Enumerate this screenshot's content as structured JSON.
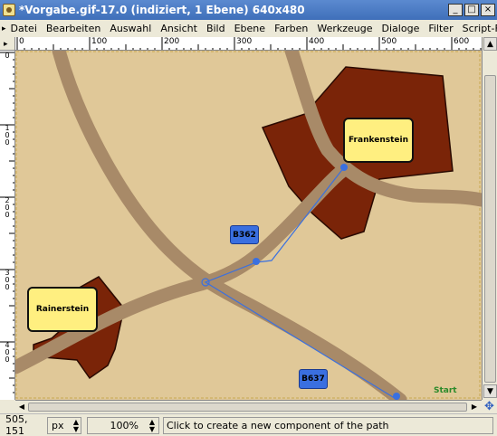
{
  "window": {
    "title": "*Vorgabe.gif-17.0 (indiziert, 1 Ebene) 640x480",
    "minimize_label": "_",
    "maximize_label": "□",
    "close_label": "×"
  },
  "menu": {
    "items": [
      "Datei",
      "Bearbeiten",
      "Auswahl",
      "Ansicht",
      "Bild",
      "Ebene",
      "Farben",
      "Werkzeuge",
      "Dialoge",
      "Filter",
      "Script-Fu"
    ]
  },
  "ruler": {
    "h_labels": [
      "0",
      "100",
      "200",
      "300",
      "400",
      "500",
      "600"
    ],
    "v_labels": [
      "0",
      "100",
      "200",
      "300",
      "400"
    ]
  },
  "map": {
    "towns": [
      "Frankenstein",
      "Rainerstein"
    ],
    "road_signs": [
      "B362",
      "B637"
    ],
    "start_label": "Start",
    "colors": {
      "background": "#e0c898",
      "town_area": "#7a2408",
      "road": "#a88a68",
      "path": "#3a70e0",
      "label_fill": "#ffef80"
    }
  },
  "status": {
    "coords": "505, 151",
    "unit": "px",
    "zoom": "100%",
    "message": "Click to create a new component of the path"
  }
}
